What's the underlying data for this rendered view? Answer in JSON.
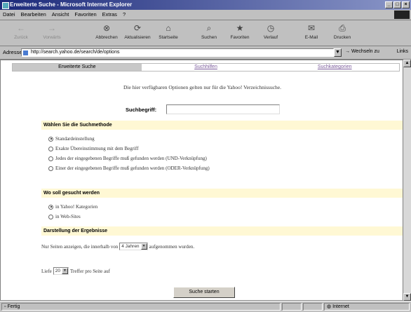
{
  "window": {
    "title": "Erweiterte Suche - Microsoft Internet Explorer",
    "controls": [
      "minimize-icon",
      "maximize-icon",
      "close-icon"
    ]
  },
  "menu": [
    "Datei",
    "Bearbeiten",
    "Ansicht",
    "Favoriten",
    "Extras",
    "?"
  ],
  "toolbar": [
    {
      "label": "Zurück",
      "icon": "back-arrow-icon",
      "glyph": "←",
      "enabled": false
    },
    {
      "label": "Vorwärts",
      "icon": "forward-arrow-icon",
      "glyph": "→",
      "enabled": false
    },
    {
      "label": "Abbrechen",
      "icon": "stop-icon",
      "glyph": "⊗",
      "enabled": true
    },
    {
      "label": "Aktualisieren",
      "icon": "refresh-icon",
      "glyph": "⟳",
      "enabled": true
    },
    {
      "label": "Startseite",
      "icon": "home-icon",
      "glyph": "⌂",
      "enabled": true
    },
    {
      "label": "Suchen",
      "icon": "search-icon",
      "glyph": "⌕",
      "enabled": true
    },
    {
      "label": "Favoriten",
      "icon": "favorites-icon",
      "glyph": "★",
      "enabled": true
    },
    {
      "label": "Verlauf",
      "icon": "history-icon",
      "glyph": "◷",
      "enabled": true
    },
    {
      "label": "E-Mail",
      "icon": "mail-icon",
      "glyph": "✉",
      "enabled": true
    },
    {
      "label": "Drucken",
      "icon": "print-icon",
      "glyph": "⎙",
      "enabled": true
    }
  ],
  "address": {
    "label": "Adresse",
    "url": "http://search.yahoo.de/search/de/options",
    "go_label": "Wechseln zu",
    "links_label": "Links"
  },
  "tabs": [
    {
      "label": "Erweiterte Suche",
      "active": true
    },
    {
      "label": "Suchhilfen",
      "active": false
    },
    {
      "label": "Suchkategorien",
      "active": false
    }
  ],
  "intro": "Die hier verfügbaren Optionen gelten nur für die Yahoo! Verzeichnissuche.",
  "search": {
    "label": "Suchbegriff:",
    "value": ""
  },
  "method": {
    "heading": "Wählen Sie die Suchmethode",
    "options": [
      {
        "label": "Standardeinstellung",
        "checked": true
      },
      {
        "label": "Exakte Übereinstimmung mit dem Begriff",
        "checked": false
      },
      {
        "label": "Jedes der eingegebenen Begriffe muß gefunden werden (UND-Verknüpfung)",
        "checked": false
      },
      {
        "label": "Einer der eingegebenen Begriffe muß gefunden werden (ODER-Verknüpfung)",
        "checked": false
      }
    ]
  },
  "where": {
    "heading": "Wo soll gesucht werden",
    "options": [
      {
        "label": "in Yahoo! Kategorien",
        "checked": true
      },
      {
        "label": "in Web-Sites",
        "checked": false
      }
    ]
  },
  "display": {
    "heading": "Darstellung der Ergebnisse",
    "age_prefix": "Nur Seiten anzeigen, die innerhalb von",
    "age_value": "4 Jahren",
    "age_suffix": "aufgenommen wurden.",
    "count_prefix": "Liefe",
    "count_value": "20",
    "count_suffix": "Treffer pro Seite auf"
  },
  "submit_label": "Suche starten",
  "status": {
    "left": "Fertig",
    "zone": "Internet"
  }
}
